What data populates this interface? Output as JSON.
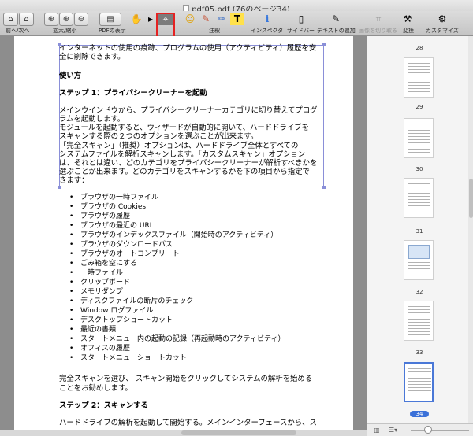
{
  "window": {
    "title": "pdf05.pdf (76のページ34)"
  },
  "toolbar": {
    "labels": [
      "前へ/次へ",
      "拡大/縮小",
      "PDFの表示",
      "注釈",
      "インスペクタ",
      "サイドバー",
      "テキストの追加",
      "画像を切り取る",
      "変換",
      "カスタマイズ"
    ],
    "tool_glyphs": [
      "⌂",
      "⌂",
      "⊕",
      "⊕",
      "⊖",
      "▤",
      "✋",
      "▸",
      "⌖",
      "☺",
      "✎",
      "✏",
      "T",
      "ℹ",
      "▯",
      "✎",
      "⌗",
      "⚒",
      "⚙"
    ]
  },
  "document": {
    "paragraphs": [
      "インターネットの使用の痕跡、プログラムの使用（アクティビティ）履歴を安",
      "全に削除できます。",
      "使い方",
      "ステップ 1：プライバシークリーナーを起動",
      "メインウインドウから、プライバシークリーナーカテゴリに切り替えてプログ",
      "ラムを起動します。",
      "モジュールを起動すると、ウィザードが自動的に開いて、ハードドライブを",
      "スキャンする際の２つのオプションを選ぶことが出来ます。",
      "「完全スキャン」（推奨）オプションは、ハードドライブ全体とすべての",
      "システムファイルを解析スキャンします。「カスタムスキャン」オプション",
      "は、それとは違い、どのカテゴリをプライバシークリーナーが解析すべきかを",
      "選ぶことが出来ます。どのカテゴリをスキャンするかを下の項目から指定で",
      "きます："
    ],
    "list": [
      "ブラウザの一時ファイル",
      "ブラウザの Cookies",
      "ブラウザの履歴",
      "ブラウザの最近の URL",
      "ブラウザのインデックスファイル（開始時のアクティビティ）",
      "ブラウザのダウンロードパス",
      "ブラウザのオートコンプリート",
      "ごみ箱を空にする",
      "一時ファイル",
      "クリップボード",
      "メモリダンプ",
      "ディスクファイルの断片のチェック",
      "Window ログファイル",
      "デスクトップショートカット",
      "最近の書類",
      "スタートメニュー内の起動の記録（再起動時のアクティビティ）",
      "オフィスの履歴",
      "スタートメニューショートカット"
    ],
    "footer": [
      "完全スキャンを選び、 スキャン開始をクリックしてシステムの解析を始める",
      "ことをお勧めします。",
      "ステップ 2：スキャンする",
      "ハードドライブの解析を起動して開始する。メインインターフェースから、ス"
    ]
  },
  "sidebar": {
    "pages": [
      "28",
      "29",
      "30",
      "31",
      "32",
      "33",
      "34"
    ],
    "current_page": "34"
  }
}
